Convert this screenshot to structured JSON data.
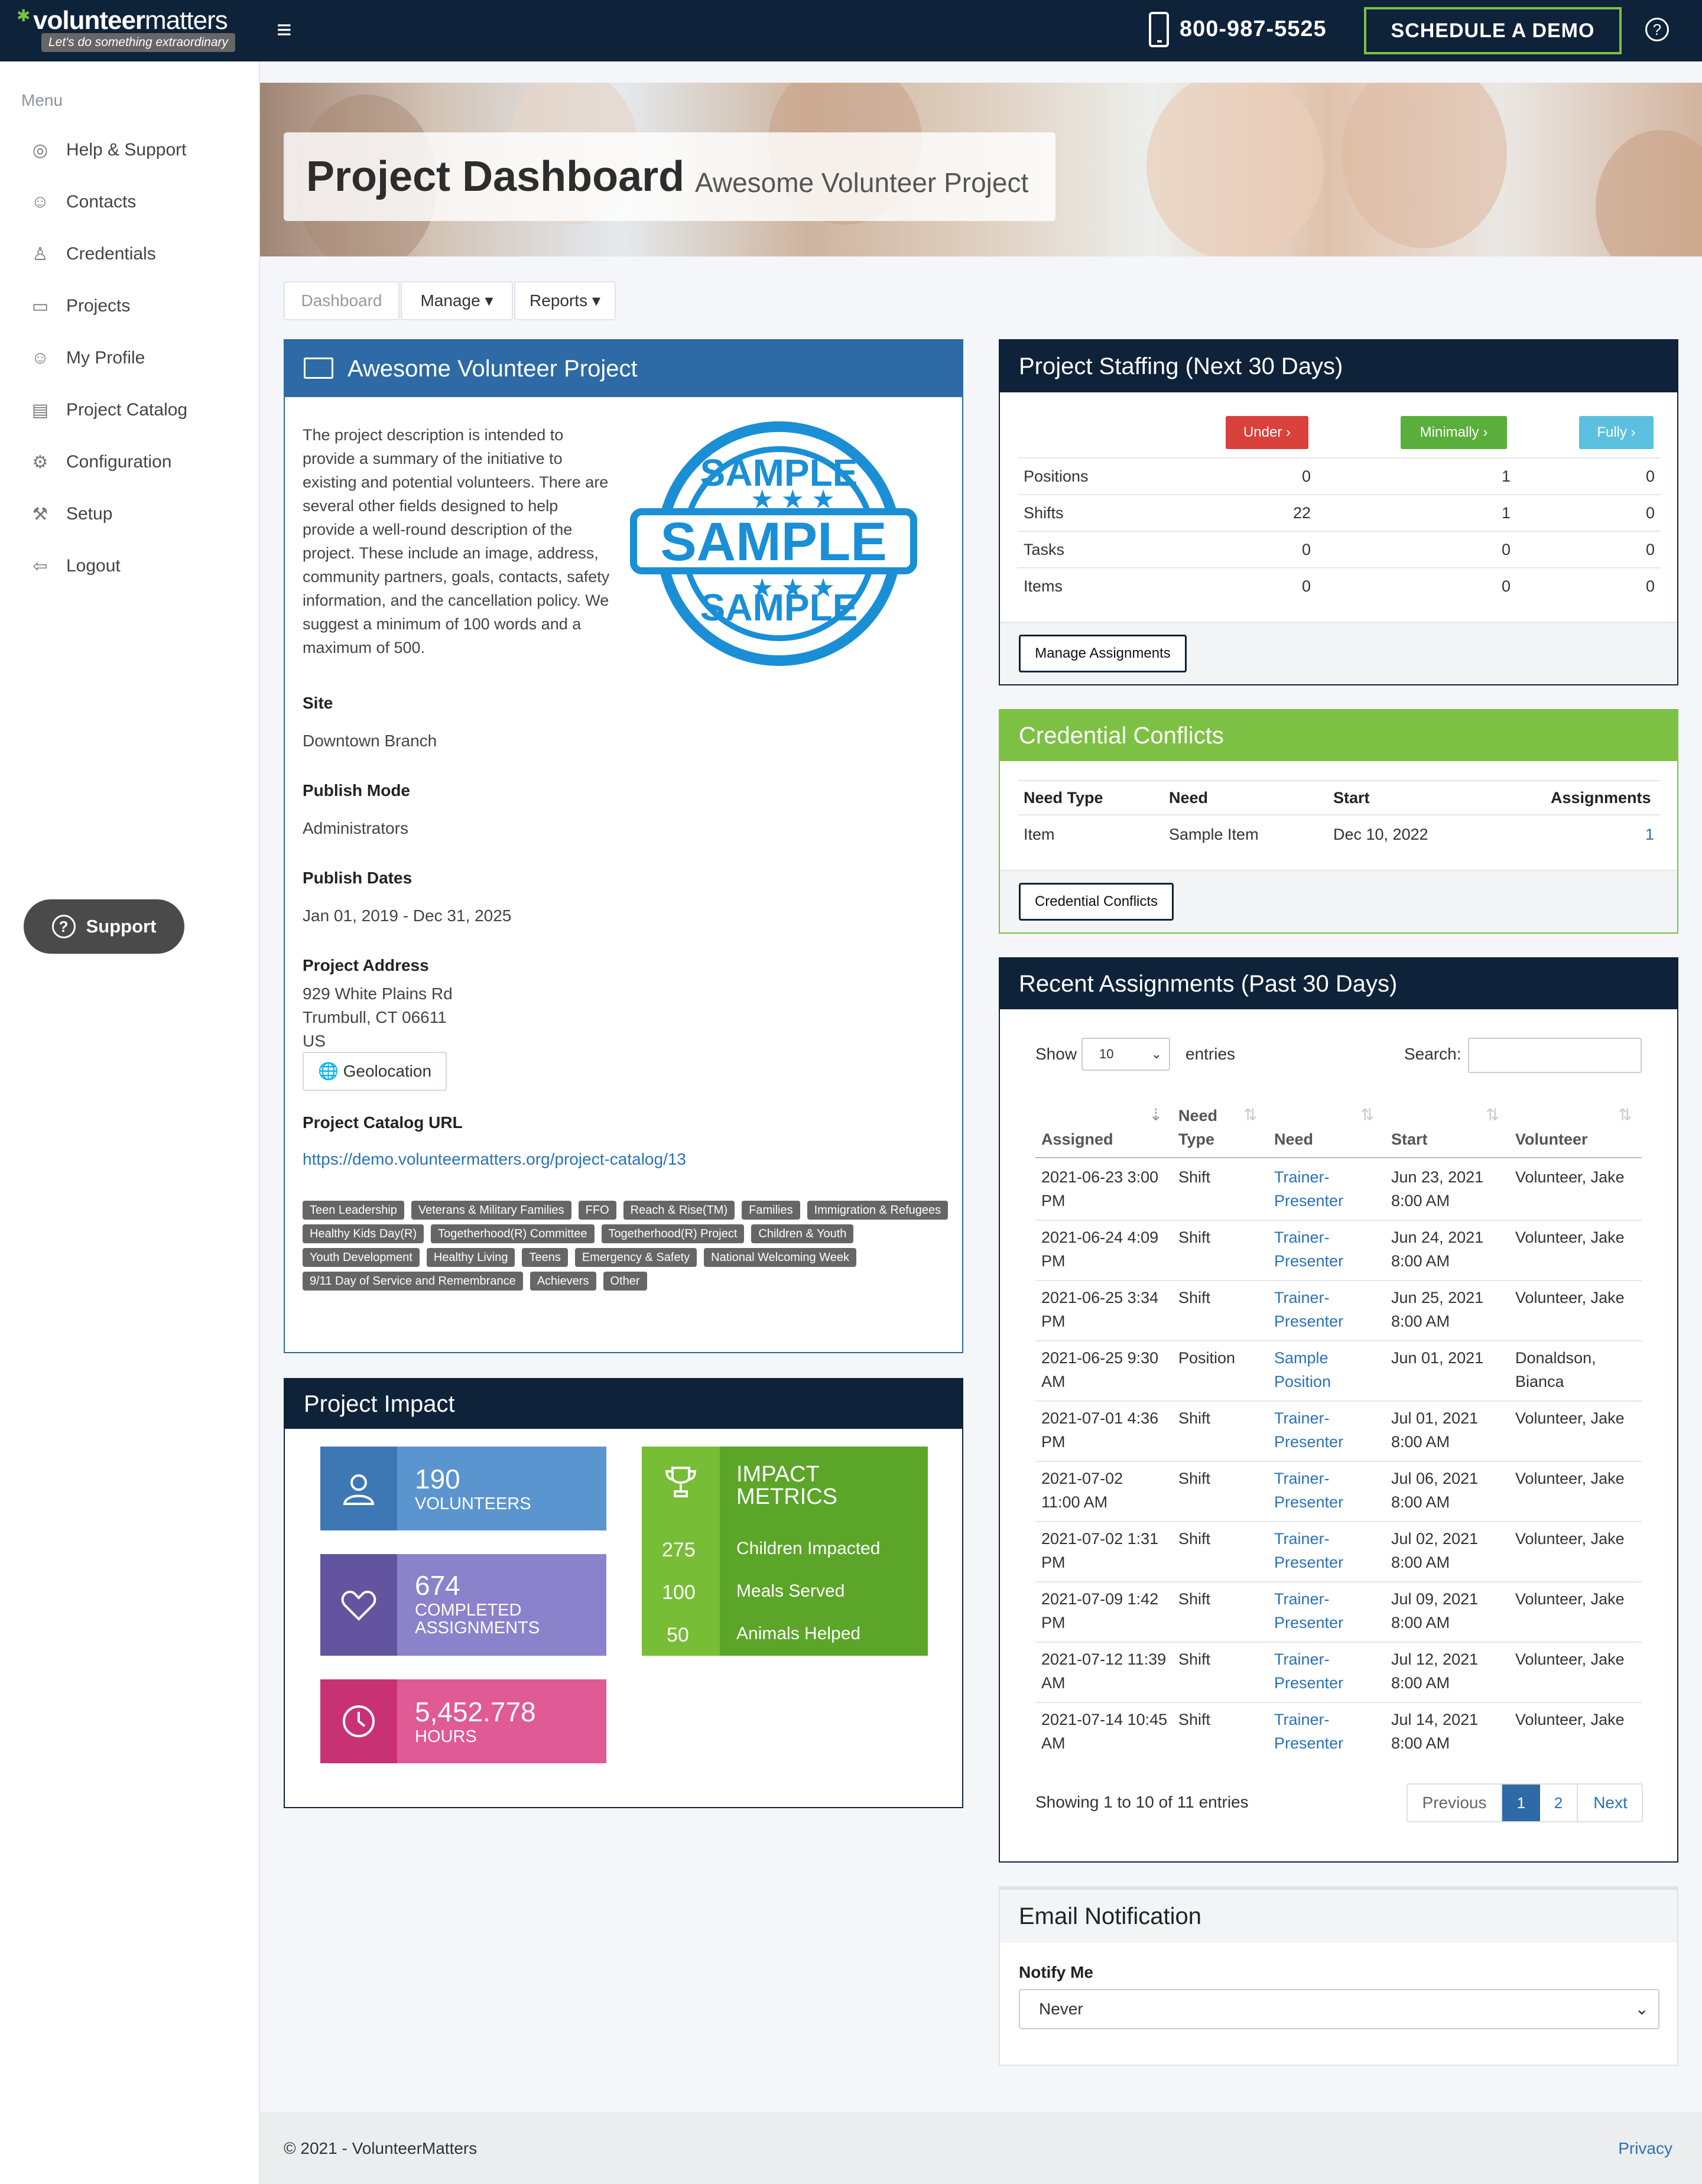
{
  "header": {
    "logo_word_bold": "volunteer",
    "logo_word_light": "matters",
    "logo_tagline": "Let's do something extraordinary",
    "phone": "800-987-5525",
    "demo_label": "SCHEDULE A DEMO",
    "help_label": "?"
  },
  "sidebar": {
    "menu_title": "Menu",
    "items": [
      {
        "label": "Help & Support",
        "icon": "lifebuoy-icon"
      },
      {
        "label": "Contacts",
        "icon": "contacts-icon"
      },
      {
        "label": "Credentials",
        "icon": "credentials-icon"
      },
      {
        "label": "Projects",
        "icon": "folder-icon"
      },
      {
        "label": "My Profile",
        "icon": "smile-icon"
      },
      {
        "label": "Project Catalog",
        "icon": "catalog-icon"
      },
      {
        "label": "Configuration",
        "icon": "gear-icon"
      },
      {
        "label": "Setup",
        "icon": "wrench-icon"
      },
      {
        "label": "Logout",
        "icon": "logout-icon"
      }
    ],
    "support_label": "Support"
  },
  "banner": {
    "title": "Project Dashboard",
    "subtitle": "Awesome Volunteer Project"
  },
  "tabs": {
    "dashboard": "Dashboard",
    "manage": "Manage",
    "reports": "Reports"
  },
  "project": {
    "panel_title": "Awesome Volunteer Project",
    "description": "The project description is intended to provide a summary of the initiative to existing and potential volunteers. There are several other fields designed to help provide a well-round description of the project. These include an image, address, community partners, goals, contacts, safety information, and the cancellation policy. We suggest a minimum of 100 words and a maximum of 500.",
    "stamp_text": "SAMPLE",
    "site_label": "Site",
    "site": "Downtown Branch",
    "publish_mode_label": "Publish Mode",
    "publish_mode": "Administrators",
    "publish_dates_label": "Publish Dates",
    "publish_dates": "Jan 01, 2019 - Dec 31, 2025",
    "address_label": "Project Address",
    "address_line1": "929 White Plains Rd",
    "address_line2": "Trumbull, CT 06611",
    "address_line3": "US",
    "geolocation_label": "Geolocation",
    "catalog_url_label": "Project Catalog URL",
    "catalog_url": "https://demo.volunteermatters.org/project-catalog/13",
    "tags": [
      "Teen Leadership",
      "Veterans & Military Families",
      "FFO",
      "Reach & Rise(TM)",
      "Families",
      "Immigration & Refugees",
      "Healthy Kids Day(R)",
      "Togetherhood(R) Committee",
      "Togetherhood(R) Project",
      "Children & Youth",
      "Youth Development",
      "Healthy Living",
      "Teens",
      "Emergency & Safety",
      "National Welcoming Week",
      "9/11 Day of Service and Remembrance",
      "Achievers",
      "Other"
    ]
  },
  "impact": {
    "title": "Project Impact",
    "volunteers_num": "190",
    "volunteers_label": "VOLUNTEERS",
    "assignments_num": "674",
    "assignments_label1": "COMPLETED",
    "assignments_label2": "ASSIGNMENTS",
    "hours_num": "5,452.778",
    "hours_label": "HOURS",
    "metrics_title1": "IMPACT",
    "metrics_title2": "METRICS",
    "metrics": [
      {
        "value": "275",
        "label": "Children Impacted"
      },
      {
        "value": "100",
        "label": "Meals Served"
      },
      {
        "value": "50",
        "label": "Animals Helped"
      }
    ],
    "colors": {
      "volunteers": "#5b95cf",
      "assignments": "#8b82cc",
      "hours": "#e05a95",
      "metrics": "#5ba528"
    }
  },
  "staffing": {
    "title": "Project Staffing (Next 30 Days)",
    "under": "Under",
    "minimally": "Minimally",
    "fully": "Fully",
    "rows": [
      {
        "label": "Positions",
        "under": "0",
        "min": "1",
        "full": "0"
      },
      {
        "label": "Shifts",
        "under": "22",
        "min": "1",
        "full": "0"
      },
      {
        "label": "Tasks",
        "under": "0",
        "min": "0",
        "full": "0"
      },
      {
        "label": "Items",
        "under": "0",
        "min": "0",
        "full": "0"
      }
    ],
    "manage_btn": "Manage Assignments"
  },
  "conflicts": {
    "title": "Credential Conflicts",
    "headers": [
      "Need Type",
      "Need",
      "Start",
      "Assignments"
    ],
    "row": {
      "need_type": "Item",
      "need": "Sample Item",
      "start": "Dec 10, 2022",
      "assignments": "1"
    },
    "btn": "Credential Conflicts"
  },
  "recent": {
    "title": "Recent Assignments (Past 30 Days)",
    "show_label": "Show",
    "show_value": "10",
    "entries_label": "entries",
    "search_label": "Search:",
    "headers": [
      "Assigned",
      "Need Type",
      "Need",
      "Start",
      "Volunteer"
    ],
    "rows": [
      {
        "a1": "2021-06-23 3:00",
        "a2": "PM",
        "type": "Shift",
        "n1": "Trainer-",
        "n2": "Presenter",
        "s1": "Jun 23, 2021",
        "s2": "8:00 AM",
        "v1": "Volunteer, Jake",
        "v2": ""
      },
      {
        "a1": "2021-06-24 4:09",
        "a2": "PM",
        "type": "Shift",
        "n1": "Trainer-",
        "n2": "Presenter",
        "s1": "Jun 24, 2021",
        "s2": "8:00 AM",
        "v1": "Volunteer, Jake",
        "v2": ""
      },
      {
        "a1": "2021-06-25 3:34",
        "a2": "PM",
        "type": "Shift",
        "n1": "Trainer-",
        "n2": "Presenter",
        "s1": "Jun 25, 2021",
        "s2": "8:00 AM",
        "v1": "Volunteer, Jake",
        "v2": ""
      },
      {
        "a1": "2021-06-25 9:30",
        "a2": "AM",
        "type": "Position",
        "n1": "Sample",
        "n2": "Position",
        "s1": "Jun 01, 2021",
        "s2": "",
        "v1": "Donaldson,",
        "v2": "Bianca"
      },
      {
        "a1": "2021-07-01 4:36",
        "a2": "PM",
        "type": "Shift",
        "n1": "Trainer-",
        "n2": "Presenter",
        "s1": "Jul 01, 2021",
        "s2": "8:00 AM",
        "v1": "Volunteer, Jake",
        "v2": ""
      },
      {
        "a1": "2021-07-02",
        "a2": "11:00 AM",
        "type": "Shift",
        "n1": "Trainer-",
        "n2": "Presenter",
        "s1": "Jul 06, 2021",
        "s2": "8:00 AM",
        "v1": "Volunteer, Jake",
        "v2": ""
      },
      {
        "a1": "2021-07-02 1:31",
        "a2": "PM",
        "type": "Shift",
        "n1": "Trainer-",
        "n2": "Presenter",
        "s1": "Jul 02, 2021",
        "s2": "8:00 AM",
        "v1": "Volunteer, Jake",
        "v2": ""
      },
      {
        "a1": "2021-07-09 1:42",
        "a2": "PM",
        "type": "Shift",
        "n1": "Trainer-",
        "n2": "Presenter",
        "s1": "Jul 09, 2021",
        "s2": "8:00 AM",
        "v1": "Volunteer, Jake",
        "v2": ""
      },
      {
        "a1": "2021-07-12 11:39",
        "a2": "AM",
        "type": "Shift",
        "n1": "Trainer-",
        "n2": "Presenter",
        "s1": "Jul 12, 2021",
        "s2": "8:00 AM",
        "v1": "Volunteer, Jake",
        "v2": ""
      },
      {
        "a1": "2021-07-14 10:45",
        "a2": "AM",
        "type": "Shift",
        "n1": "Trainer-",
        "n2": "Presenter",
        "s1": "Jul 14, 2021",
        "s2": "8:00 AM",
        "v1": "Volunteer, Jake",
        "v2": ""
      }
    ],
    "showing": "Showing 1 to 10 of 11 entries",
    "prev": "Previous",
    "page1": "1",
    "page2": "2",
    "next": "Next"
  },
  "email": {
    "title": "Email Notification",
    "notify_label": "Notify Me",
    "notify_value": "Never"
  },
  "footer": {
    "copyright": "© 2021 - VolunteerMatters",
    "privacy": "Privacy"
  }
}
